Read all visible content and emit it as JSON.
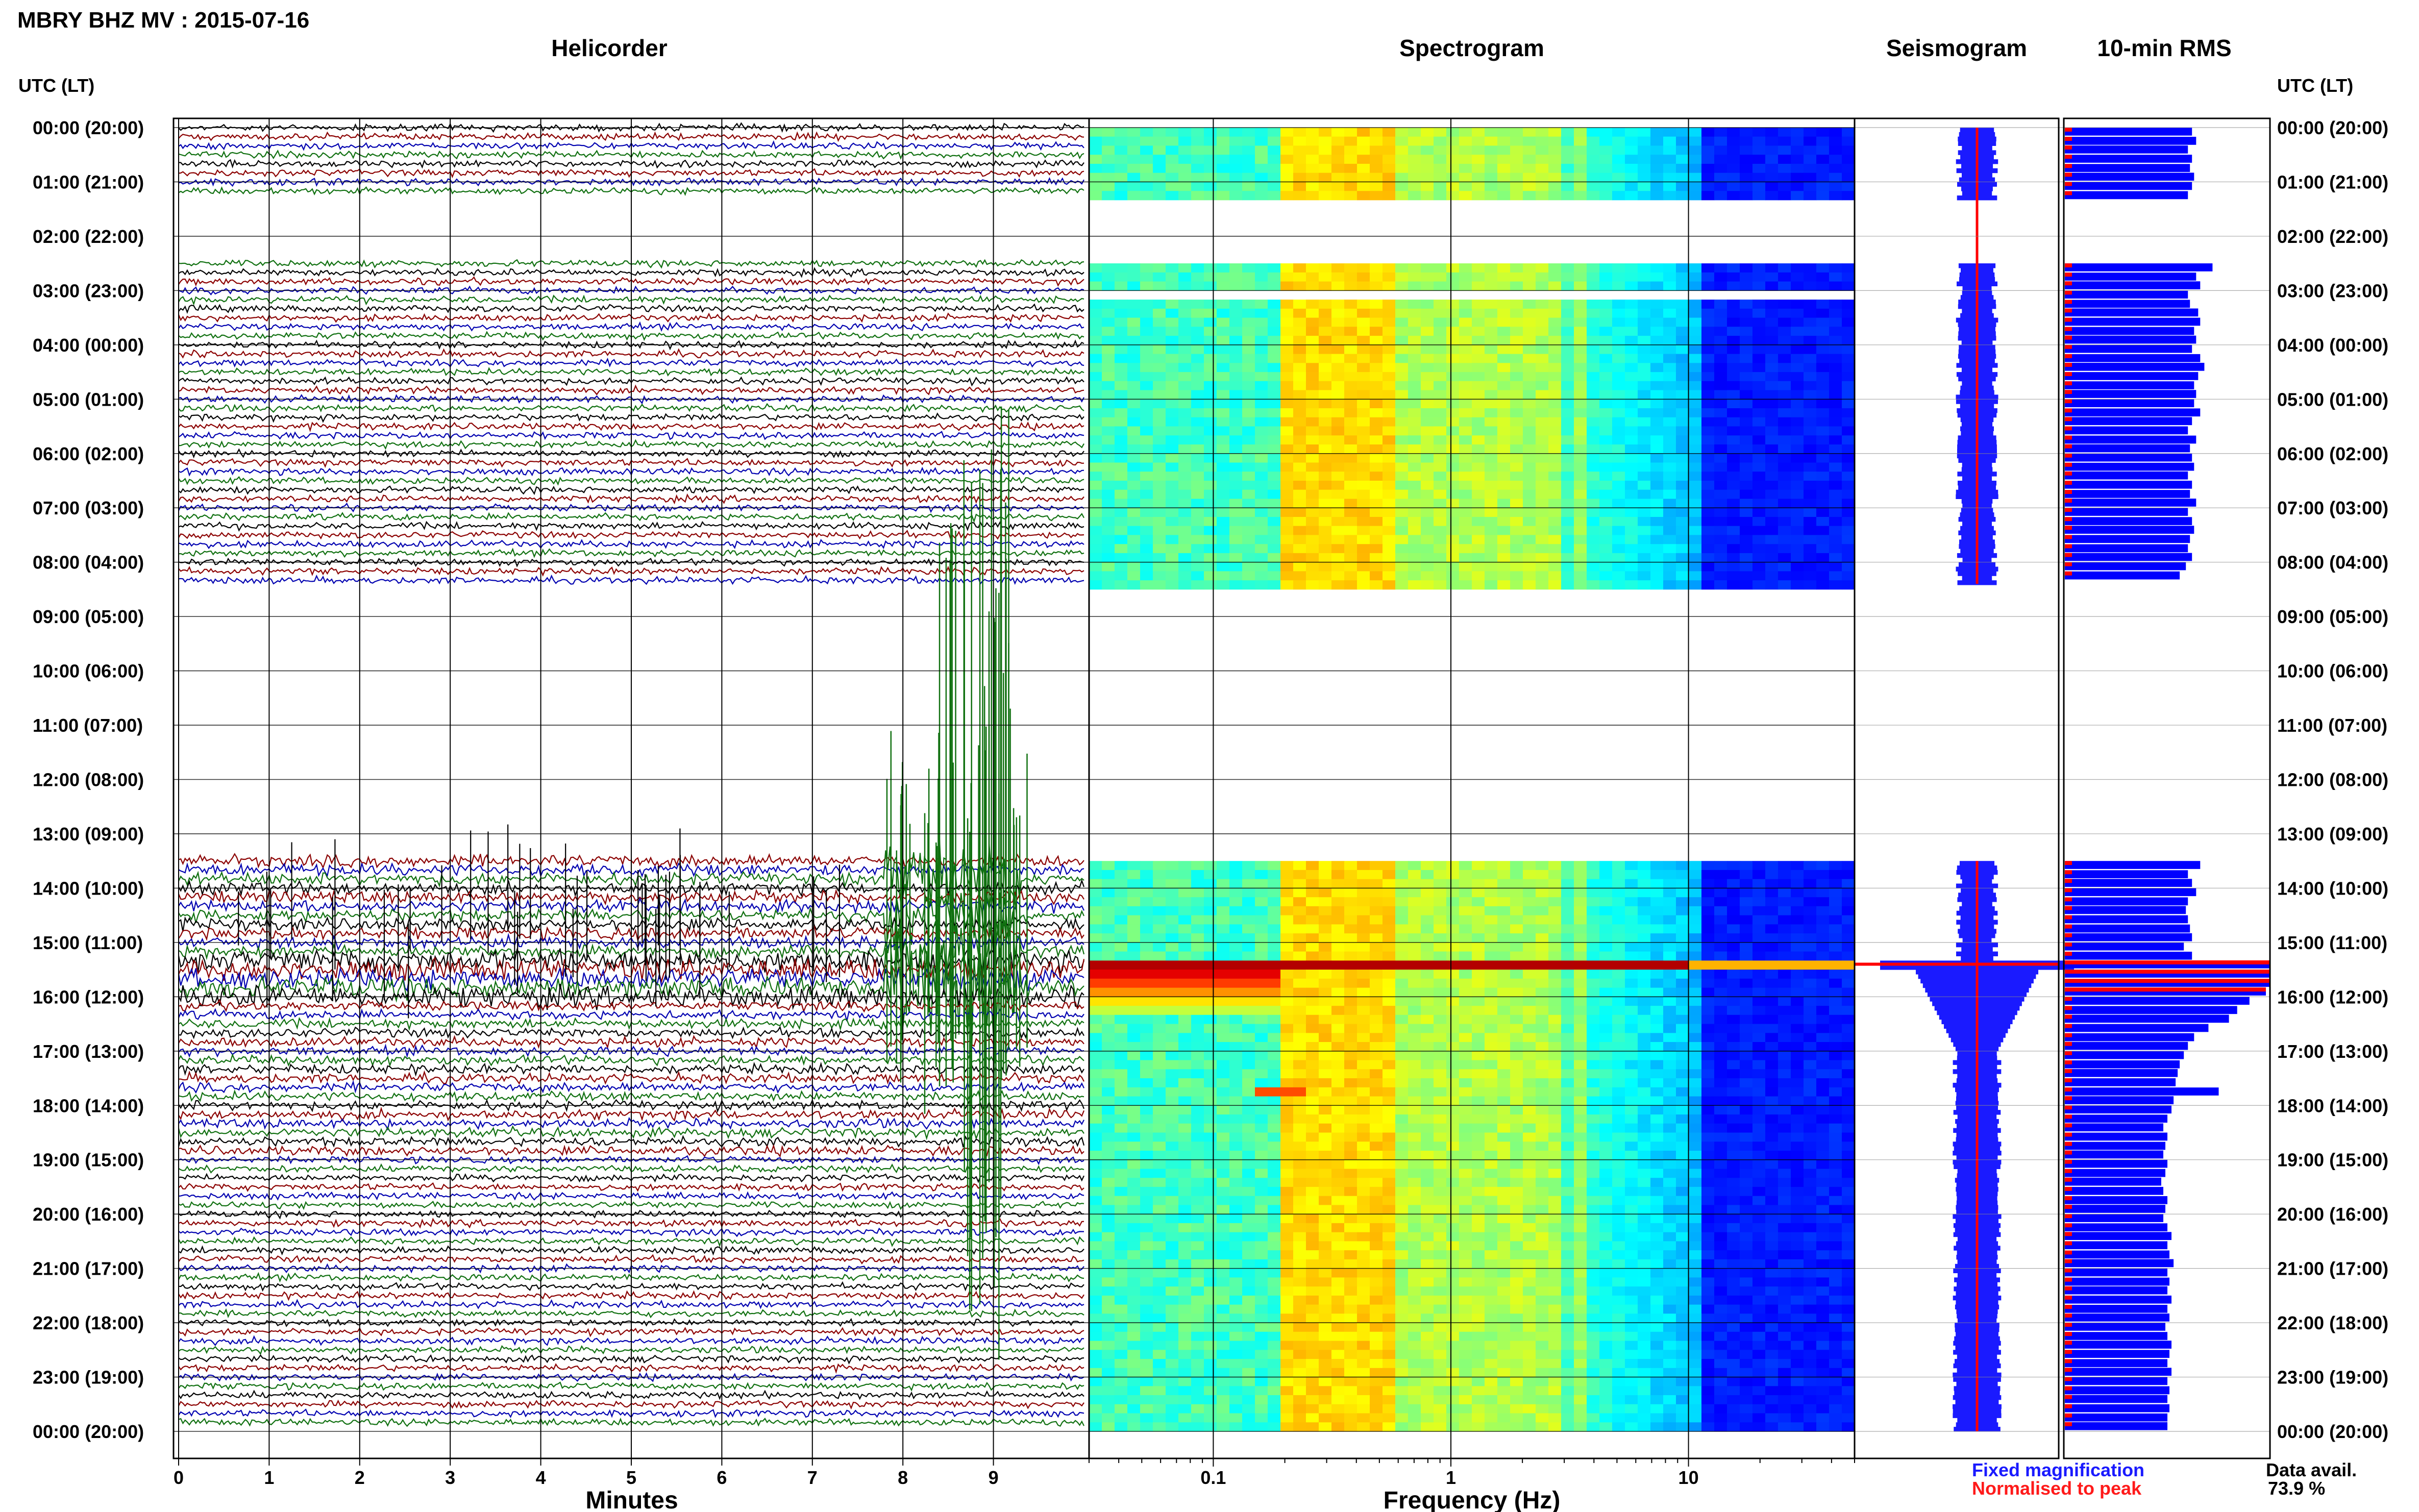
{
  "title": "MBRY BHZ MV : 2015-07-16",
  "footer": {
    "fixed_magnification": "Fixed magnification",
    "normalised_to_peak": "Normalised to peak",
    "data_avail_label": "Data avail.",
    "data_avail_value": "73.9 %"
  },
  "colors": {
    "trace_cycle": [
      "#000000",
      "#8b0000",
      "#0000b0",
      "#107010"
    ],
    "fixed_magnification": "#1a1aff",
    "normalised_to_peak": "#ff1a1a",
    "rms_bar": "#0000ff",
    "rms_norm": "#ff0000",
    "seis_peak": "#ff0000"
  },
  "chart_data": [
    {
      "type": "line",
      "title": "Helicorder",
      "xlabel": "Minutes",
      "ylabel": "UTC (LT)",
      "xlim": [
        0,
        10
      ],
      "x_ticks": [
        "0",
        "1",
        "2",
        "3",
        "4",
        "5",
        "6",
        "7",
        "8",
        "9"
      ],
      "y_ticks": [
        "00:00 (20:00)",
        "01:00 (21:00)",
        "02:00 (22:00)",
        "03:00 (23:00)",
        "04:00 (00:00)",
        "05:00 (01:00)",
        "06:00 (02:00)",
        "07:00 (03:00)",
        "08:00 (04:00)",
        "09:00 (05:00)",
        "10:00 (06:00)",
        "11:00 (07:00)",
        "12:00 (08:00)",
        "13:00 (09:00)",
        "14:00 (10:00)",
        "15:00 (11:00)",
        "16:00 (12:00)",
        "17:00 (13:00)",
        "18:00 (14:00)",
        "19:00 (15:00)",
        "20:00 (16:00)",
        "21:00 (17:00)",
        "22:00 (18:00)",
        "23:00 (19:00)",
        "00:00 (20:00)"
      ],
      "lines_per_hour": 6,
      "minutes_per_line": 10,
      "data_segments_utc_hours": [
        [
          0.0,
          1.3
        ],
        [
          2.5,
          8.4
        ],
        [
          13.5,
          24.0
        ]
      ],
      "annotations": [
        "large signal 15:25-16:00 UTC",
        "high-amplitude green trace 13:00-24:00 near minute 8-9"
      ],
      "grid": true
    },
    {
      "type": "heatmap",
      "title": "Spectrogram",
      "xlabel": "Frequency (Hz)",
      "x_scale": "log",
      "xlim": [
        0.03,
        50
      ],
      "x_ticks": [
        "0.1",
        "1",
        "10"
      ],
      "colormap": "jet",
      "data_segments_utc_hours": [
        [
          0.0,
          1.3
        ],
        [
          2.5,
          2.95
        ],
        [
          3.1,
          8.4
        ],
        [
          13.5,
          14.1
        ],
        [
          14.2,
          24.0
        ]
      ],
      "annotations": [
        "broadband high energy at 15:25 UTC",
        "low-frequency high energy 15:30-16:15 UTC below 0.2 Hz",
        "narrow band near 0.2 Hz at 17:40 UTC"
      ]
    },
    {
      "type": "area",
      "title": "Seismogram",
      "series": [
        {
          "name": "Fixed magnification",
          "peak_hour_utc": 15.4
        },
        {
          "name": "Normalised to peak",
          "peak_hour_utc": 15.4
        }
      ]
    },
    {
      "type": "bar",
      "title": "10-min RMS",
      "ylabel": "UTC (LT)",
      "y_ticks": [
        "00:00 (20:00)",
        "01:00 (21:00)",
        "02:00 (22:00)",
        "03:00 (23:00)",
        "04:00 (00:00)",
        "05:00 (01:00)",
        "06:00 (02:00)",
        "07:00 (03:00)",
        "08:00 (04:00)",
        "09:00 (05:00)",
        "10:00 (06:00)",
        "11:00 (07:00)",
        "12:00 (08:00)",
        "13:00 (09:00)",
        "14:00 (10:00)",
        "15:00 (11:00)",
        "16:00 (12:00)",
        "17:00 (13:00)",
        "18:00 (14:00)",
        "19:00 (15:00)",
        "20:00 (16:00)",
        "21:00 (17:00)",
        "22:00 (18:00)",
        "23:00 (19:00)",
        "00:00 (20:00)"
      ],
      "bin_minutes": 10,
      "rms_relative": [
        [
          0.0,
          0.62
        ],
        [
          0.17,
          0.64
        ],
        [
          0.33,
          0.6
        ],
        [
          0.5,
          0.62
        ],
        [
          0.67,
          0.61
        ],
        [
          0.83,
          0.63
        ],
        [
          1.0,
          0.62
        ],
        [
          1.17,
          0.6
        ],
        [
          2.5,
          0.72
        ],
        [
          2.67,
          0.64
        ],
        [
          2.83,
          0.66
        ],
        [
          3.0,
          0.6
        ],
        [
          3.17,
          0.61
        ],
        [
          3.33,
          0.65
        ],
        [
          3.5,
          0.66
        ],
        [
          3.67,
          0.63
        ],
        [
          3.83,
          0.64
        ],
        [
          4.0,
          0.62
        ],
        [
          4.17,
          0.66
        ],
        [
          4.33,
          0.68
        ],
        [
          4.5,
          0.65
        ],
        [
          4.67,
          0.63
        ],
        [
          4.83,
          0.64
        ],
        [
          5.0,
          0.63
        ],
        [
          5.17,
          0.66
        ],
        [
          5.33,
          0.62
        ],
        [
          5.5,
          0.6
        ],
        [
          5.67,
          0.64
        ],
        [
          5.83,
          0.61
        ],
        [
          6.0,
          0.62
        ],
        [
          6.17,
          0.63
        ],
        [
          6.33,
          0.6
        ],
        [
          6.5,
          0.62
        ],
        [
          6.67,
          0.61
        ],
        [
          6.83,
          0.64
        ],
        [
          7.0,
          0.6
        ],
        [
          7.17,
          0.62
        ],
        [
          7.33,
          0.63
        ],
        [
          7.5,
          0.61
        ],
        [
          7.67,
          0.6
        ],
        [
          7.83,
          0.62
        ],
        [
          8.0,
          0.59
        ],
        [
          8.17,
          0.56
        ],
        [
          13.5,
          0.66
        ],
        [
          13.67,
          0.6
        ],
        [
          13.83,
          0.62
        ],
        [
          14.0,
          0.64
        ],
        [
          14.17,
          0.6
        ],
        [
          14.33,
          0.59
        ],
        [
          14.5,
          0.6
        ],
        [
          14.67,
          0.61
        ],
        [
          14.83,
          0.62
        ],
        [
          15.0,
          0.58
        ],
        [
          15.17,
          0.62
        ],
        [
          15.33,
          1.0
        ],
        [
          15.5,
          1.0
        ],
        [
          15.67,
          1.0
        ],
        [
          15.83,
          0.98
        ],
        [
          16.0,
          0.9
        ],
        [
          16.17,
          0.84
        ],
        [
          16.33,
          0.8
        ],
        [
          16.5,
          0.7
        ],
        [
          16.67,
          0.63
        ],
        [
          16.83,
          0.6
        ],
        [
          17.0,
          0.58
        ],
        [
          17.17,
          0.56
        ],
        [
          17.33,
          0.55
        ],
        [
          17.5,
          0.54
        ],
        [
          17.67,
          0.75
        ],
        [
          17.83,
          0.53
        ],
        [
          18.0,
          0.52
        ],
        [
          18.17,
          0.5
        ],
        [
          18.33,
          0.48
        ],
        [
          18.5,
          0.5
        ],
        [
          18.67,
          0.49
        ],
        [
          18.83,
          0.48
        ],
        [
          19.0,
          0.5
        ],
        [
          19.17,
          0.49
        ],
        [
          19.33,
          0.47
        ],
        [
          19.5,
          0.48
        ],
        [
          19.67,
          0.5
        ],
        [
          19.83,
          0.49
        ],
        [
          20.0,
          0.48
        ],
        [
          20.17,
          0.5
        ],
        [
          20.33,
          0.52
        ],
        [
          20.5,
          0.5
        ],
        [
          20.67,
          0.51
        ],
        [
          20.83,
          0.53
        ],
        [
          21.0,
          0.5
        ],
        [
          21.17,
          0.51
        ],
        [
          21.33,
          0.5
        ],
        [
          21.5,
          0.52
        ],
        [
          21.67,
          0.5
        ],
        [
          21.83,
          0.51
        ],
        [
          22.0,
          0.49
        ],
        [
          22.17,
          0.5
        ],
        [
          22.33,
          0.52
        ],
        [
          22.5,
          0.51
        ],
        [
          22.67,
          0.5
        ],
        [
          22.83,
          0.52
        ],
        [
          23.0,
          0.5
        ],
        [
          23.17,
          0.51
        ],
        [
          23.33,
          0.5
        ],
        [
          23.5,
          0.51
        ],
        [
          23.67,
          0.5
        ],
        [
          23.83,
          0.5
        ]
      ]
    }
  ]
}
